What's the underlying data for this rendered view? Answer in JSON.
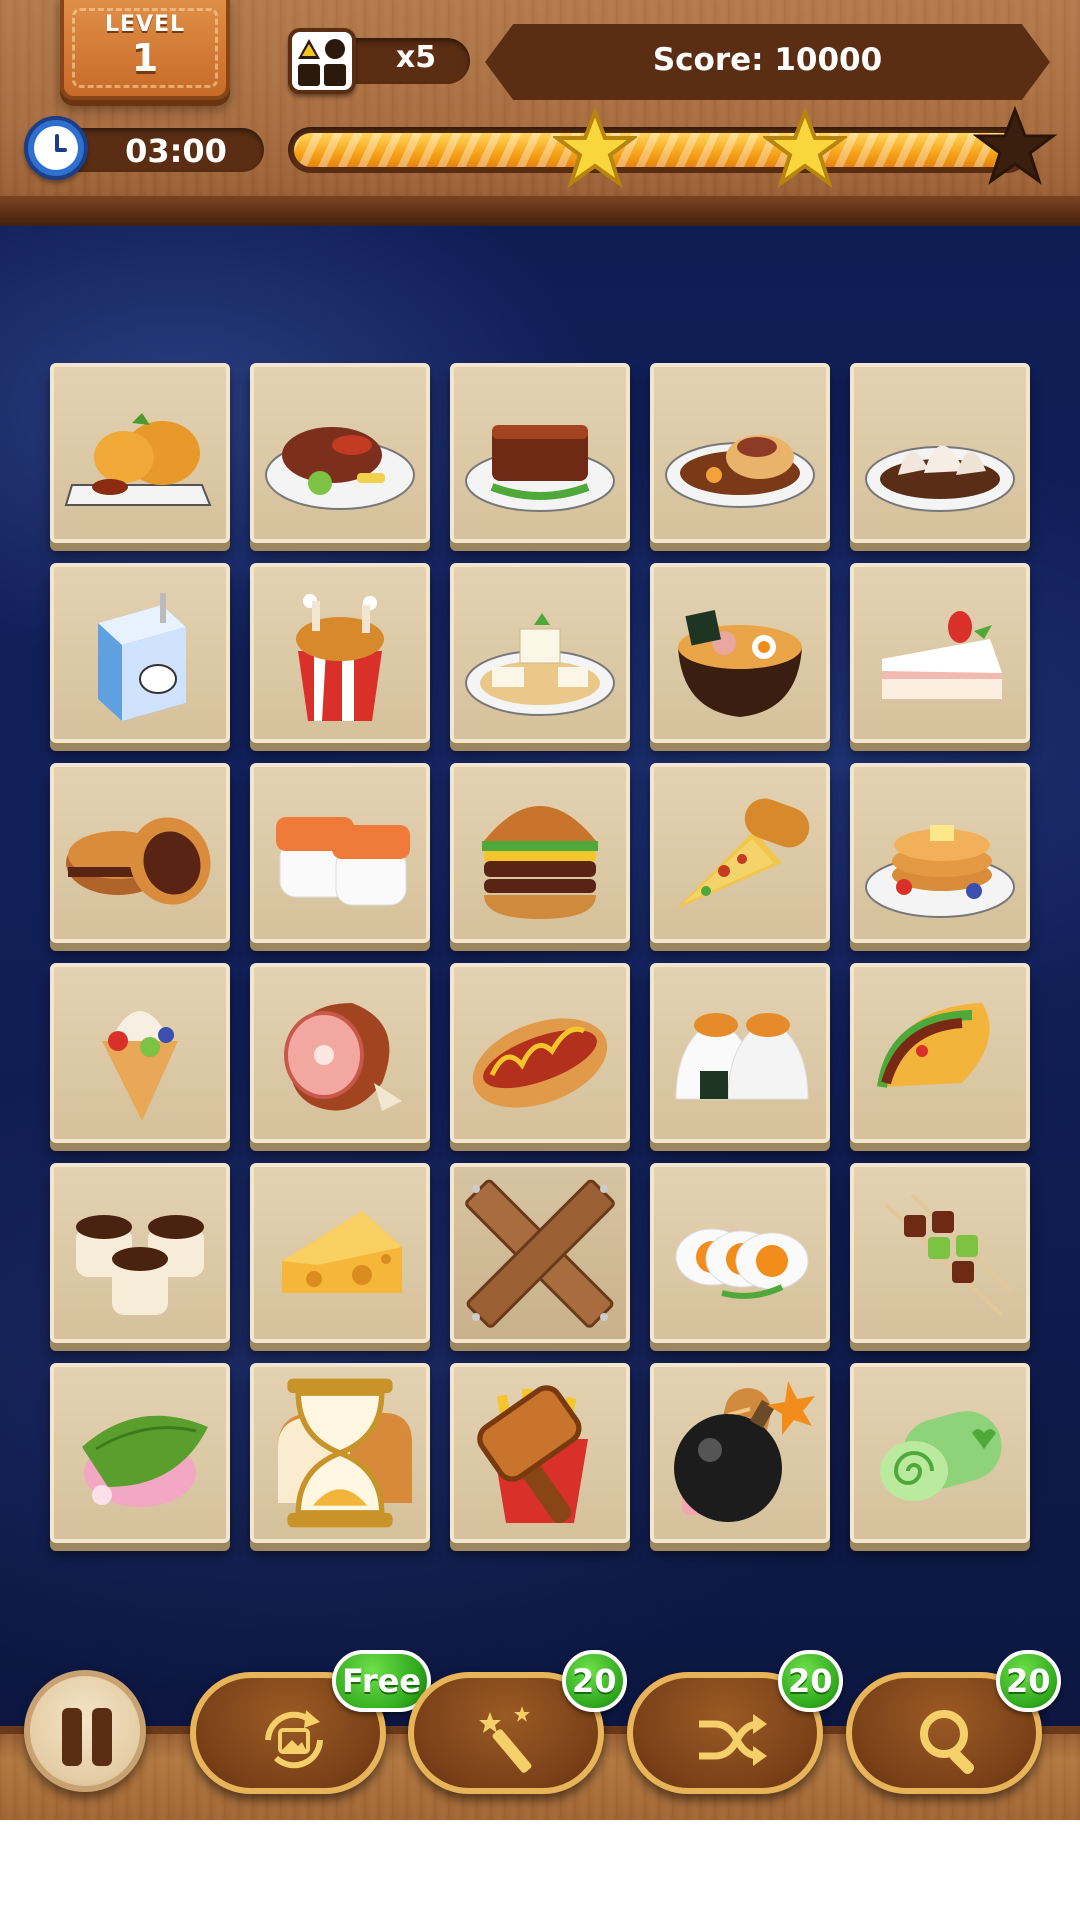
{
  "hud": {
    "level_label": "LEVEL",
    "level_number": "1",
    "moves_count": "x5",
    "score_text": "Score: 10000",
    "timer_text": "03:00",
    "progress_fraction": 1.0,
    "stars": [
      {
        "earned": true
      },
      {
        "earned": true
      },
      {
        "earned": false
      }
    ]
  },
  "board": {
    "rows": [
      [
        "fried-chicken-cutlet",
        "steak",
        "braised-pork-belly",
        "roast-fish",
        "dim-sum-dumplings"
      ],
      [
        "milk-carton",
        "fried-chicken-bucket",
        "tofu",
        "ramen",
        "strawberry-cake"
      ],
      [
        "dorayaki",
        "salmon-sushi",
        "hamburger",
        "pizza-slice",
        "pancakes"
      ],
      [
        "ice-cream-crepe",
        "ham",
        "hot-dog",
        "onigiri",
        "taco"
      ],
      [
        "chocolate-pudding",
        "cheese",
        "blocked-tile",
        "boiled-eggs",
        "skewers"
      ],
      [
        "sakura-mochi",
        "bread-loaf",
        "french-fries",
        "baguette",
        "swiss-roll"
      ]
    ],
    "powerups": [
      {
        "row": 5,
        "col": 1,
        "type": "hourglass-icon"
      },
      {
        "row": 5,
        "col": 2,
        "type": "hammer-icon"
      },
      {
        "row": 5,
        "col": 3,
        "type": "bomb-icon"
      }
    ]
  },
  "toolbar": {
    "pause_icon": "pause-icon",
    "tools": [
      {
        "icon": "refresh-image-icon",
        "badge": "Free"
      },
      {
        "icon": "magic-wand-icon",
        "badge": "20"
      },
      {
        "icon": "shuffle-icon",
        "badge": "20"
      },
      {
        "icon": "magnifier-icon",
        "badge": "20"
      }
    ]
  },
  "colors": {
    "wood": "#a86c3f",
    "board_bg": "#12205a",
    "tile": "#dccaa6",
    "badge_green": "#2fa81c",
    "progress_orange": "#f7a21b"
  }
}
